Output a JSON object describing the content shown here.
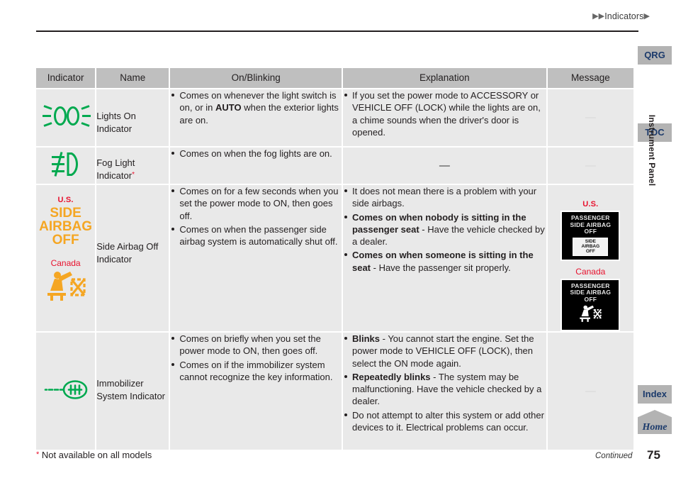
{
  "header": {
    "breadcrumb_prefix": "▶▶",
    "breadcrumb_text": "Indicators",
    "breadcrumb_suffix": "▶"
  },
  "table": {
    "columns": [
      "Indicator",
      "Name",
      "On/Blinking",
      "Explanation",
      "Message"
    ],
    "rows": [
      {
        "icon": "lights-on-indicator-icon",
        "name": "Lights On Indicator",
        "name_asterisk": "",
        "on_blinking": [
          {
            "text": "Comes on whenever the light switch is on, or in ",
            "bold": "AUTO",
            "text_after": " when the exterior lights are on."
          }
        ],
        "explanation": [
          {
            "text": "If you set the power mode to ACCESSORY or VEHICLE OFF (LOCK) while the lights are on, a chime sounds when the driver's door is opened."
          }
        ],
        "message": "—"
      },
      {
        "icon": "fog-light-indicator-icon",
        "name": "Fog Light Indicator",
        "name_asterisk": "*",
        "on_blinking": [
          {
            "text": "Comes on when the fog lights are on."
          }
        ],
        "explanation_dash": "—",
        "message": "—"
      },
      {
        "icon": "side-airbag-off-indicator-icon",
        "icon_us_label": "U.S.",
        "icon_us_line1": "SIDE",
        "icon_us_line2": "AIRBAG",
        "icon_us_line3": "OFF",
        "icon_ca_label": "Canada",
        "name": "Side Airbag Off Indicator",
        "name_asterisk": "",
        "on_blinking": [
          {
            "text": "Comes on for a few seconds when you set the power mode to ON, then goes off."
          },
          {
            "text": "Comes on when the passenger side airbag system is automatically shut off."
          }
        ],
        "explanation": [
          {
            "text": "It does not mean there is a problem with your side airbags."
          },
          {
            "bold_lead": "Comes on when nobody is sitting in the passenger seat",
            "text_after": " - Have the vehicle checked by a dealer."
          },
          {
            "bold_lead": "Comes on when someone is sitting in the seat",
            "text_after": " - Have the passenger sit properly."
          }
        ],
        "message_us_label": "U.S.",
        "message_ca_label": "Canada",
        "message_box_line1": "PASSENGER",
        "message_box_line2": "SIDE AIRBAG",
        "message_box_line3": "OFF",
        "message_badge_line1": "SIDE",
        "message_badge_line2": "AIRBAG",
        "message_badge_line3": "OFF"
      },
      {
        "icon": "immobilizer-system-indicator-icon",
        "name": "Immobilizer System Indicator",
        "name_asterisk": "",
        "on_blinking": [
          {
            "text": "Comes on briefly when you set the power mode to ON, then goes off."
          },
          {
            "text": "Comes on if the immobilizer system cannot recognize the key information."
          }
        ],
        "explanation": [
          {
            "bold_lead": "Blinks",
            "text_after": " - You cannot start the engine. Set the power mode to VEHICLE OFF (LOCK), then select the ON mode again."
          },
          {
            "bold_lead": "Repeatedly blinks",
            "text_after": " - The system may be malfunctioning. Have the vehicle checked by a dealer."
          },
          {
            "text": "Do not attempt to alter this system or add other devices to it. Electrical problems can occur."
          }
        ],
        "message": "—"
      }
    ]
  },
  "rail": {
    "qrg": "QRG",
    "toc": "TOC",
    "index": "Index",
    "home": "Home",
    "section_title": "Instrument Panel"
  },
  "footer": {
    "asterisk": "*",
    "footnote": "Not available on all models",
    "continued": "Continued",
    "page_number": "75"
  },
  "colors": {
    "green_indicator": "#00a94f",
    "amber_indicator": "#f5a623",
    "red_label": "#e8112d",
    "rail_button_bg": "#b3b3b3",
    "rail_button_text": "#1b3a6b",
    "header_cell_bg": "#bfbfbf",
    "body_cell_bg": "#e9e9e9"
  }
}
